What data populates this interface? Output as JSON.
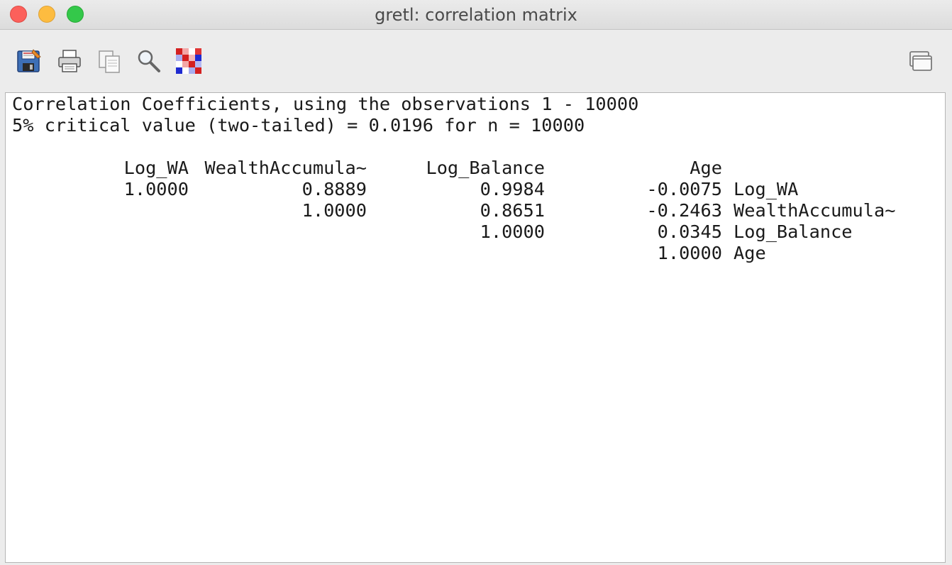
{
  "window": {
    "title": "gretl: correlation matrix"
  },
  "toolbar": {
    "buttons": [
      {
        "name": "save-as-icon",
        "tooltip": ""
      },
      {
        "name": "print-icon",
        "tooltip": ""
      },
      {
        "name": "copy-icon",
        "tooltip": ""
      },
      {
        "name": "find-icon",
        "tooltip": ""
      },
      {
        "name": "heatmap-icon",
        "tooltip": ""
      },
      {
        "name": "window-restore-icon",
        "tooltip": ""
      }
    ]
  },
  "output": {
    "heading": "Correlation Coefficients, using the observations 1 - 10000",
    "critical": "5% critical value (two-tailed) = 0.0196 for n = 10000",
    "column_headers": [
      "Log_WA",
      "WealthAccumula~",
      "Log_Balance",
      "Age"
    ],
    "rows": [
      {
        "values": [
          "1.0000",
          "0.8889",
          "0.9984",
          "-0.0075"
        ],
        "label": "Log_WA"
      },
      {
        "values": [
          "",
          "1.0000",
          "0.8651",
          "-0.2463"
        ],
        "label": "WealthAccumula~"
      },
      {
        "values": [
          "",
          "",
          "1.0000",
          "0.0345"
        ],
        "label": "Log_Balance"
      },
      {
        "values": [
          "",
          "",
          "",
          "1.0000"
        ],
        "label": "Age"
      }
    ]
  }
}
